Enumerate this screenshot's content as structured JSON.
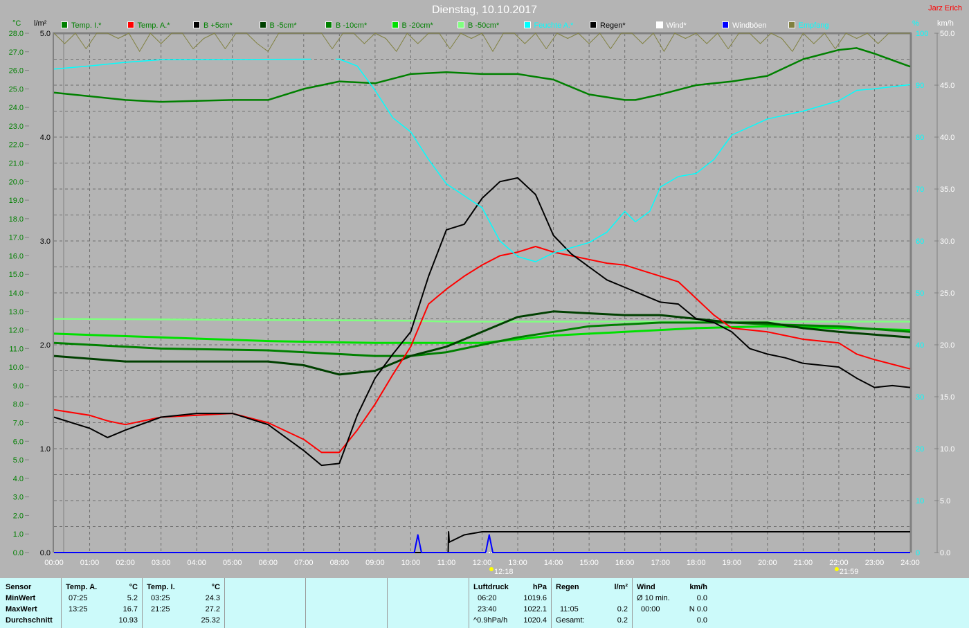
{
  "title": "Dienstag, 10.10.2017",
  "author": "Jarz Erich",
  "legend": [
    {
      "label": "Temp. I.*",
      "color": "#008000",
      "text_color": "#008000"
    },
    {
      "label": "Temp. A.*",
      "color": "#ff0000",
      "text_color": "#008000"
    },
    {
      "label": "B +5cm*",
      "color": "#000000",
      "text_color": "#008000"
    },
    {
      "label": "B -5cm*",
      "color": "#004000",
      "text_color": "#008000"
    },
    {
      "label": "B -10cm*",
      "color": "#008000",
      "text_color": "#008000"
    },
    {
      "label": "B -20cm*",
      "color": "#00e000",
      "text_color": "#008000"
    },
    {
      "label": "B -50cm*",
      "color": "#80ff80",
      "text_color": "#008000"
    },
    {
      "label": "Feuchte A.*",
      "color": "#00ffff",
      "text_color": "#00ffff"
    },
    {
      "label": "Regen*",
      "color": "#000000",
      "text_color": "#000000"
    },
    {
      "label": "Wind*",
      "color": "#ffffff",
      "text_color": "#ffffff"
    },
    {
      "label": "Windböen",
      "color": "#0000ff",
      "text_color": "#ffffff"
    },
    {
      "label": "Empfang",
      "color": "#808040",
      "text_color": "#00ffff"
    }
  ],
  "sun_markers": [
    {
      "label": "12:18",
      "hour": 12.3
    },
    {
      "label": "21:59",
      "hour": 21.98
    }
  ],
  "chart_data": {
    "type": "line",
    "title": "Dienstag, 10.10.2017",
    "x_ticks": [
      "00:00",
      "01:00",
      "02:00",
      "03:00",
      "04:00",
      "05:00",
      "06:00",
      "07:00",
      "08:00",
      "09:00",
      "10:00",
      "11:00",
      "12:00",
      "13:00",
      "14:00",
      "15:00",
      "16:00",
      "17:00",
      "18:00",
      "19:00",
      "20:00",
      "21:00",
      "22:00",
      "23:00",
      "24:00"
    ],
    "xlim": [
      0,
      24
    ],
    "axes": {
      "temp": {
        "unit": "°C",
        "ylim": [
          0,
          28
        ],
        "ticks": [
          "0.0",
          "1.0",
          "2.0",
          "3.0",
          "4.0",
          "5.0",
          "6.0",
          "7.0",
          "8.0",
          "9.0",
          "10.0",
          "11.0",
          "12.0",
          "13.0",
          "14.0",
          "15.0",
          "16.0",
          "17.0",
          "18.0",
          "19.0",
          "20.0",
          "21.0",
          "22.0",
          "23.0",
          "24.0",
          "25.0",
          "26.0",
          "27.0",
          "28.0"
        ]
      },
      "rain": {
        "unit": "l/m²",
        "ylim": [
          0,
          5
        ],
        "ticks": [
          "0.0",
          "1.0",
          "2.0",
          "3.0",
          "4.0",
          "5.0"
        ]
      },
      "humidity": {
        "unit": "%",
        "ylim": [
          0,
          100
        ],
        "ticks": [
          "0",
          "10",
          "20",
          "30",
          "40",
          "50",
          "60",
          "70",
          "80",
          "90",
          "100"
        ]
      },
      "wind": {
        "unit": "km/h",
        "ylim": [
          0,
          50
        ],
        "ticks": [
          "0.0",
          "5.0",
          "10.0",
          "15.0",
          "20.0",
          "25.0",
          "30.0",
          "35.0",
          "40.0",
          "45.0",
          "50.0"
        ]
      }
    },
    "series": [
      {
        "name": "Temp. I.*",
        "axis": "temp",
        "color": "#008000",
        "width": 2.5,
        "x": [
          0,
          2,
          3,
          5,
          6,
          7,
          8,
          9,
          10,
          11,
          12,
          13,
          14,
          15,
          16,
          16.3,
          17,
          18,
          19,
          20,
          21,
          22,
          22.5,
          23,
          24
        ],
        "y": [
          24.8,
          24.4,
          24.3,
          24.4,
          24.4,
          25.0,
          25.4,
          25.3,
          25.8,
          25.9,
          25.8,
          25.8,
          25.5,
          24.7,
          24.4,
          24.4,
          24.7,
          25.2,
          25.4,
          25.7,
          26.6,
          27.1,
          27.2,
          26.9,
          26.2
        ]
      },
      {
        "name": "B -50cm*",
        "axis": "temp",
        "color": "#80ff80",
        "width": 2.5,
        "x": [
          0,
          10,
          11,
          24
        ],
        "y": [
          12.6,
          12.5,
          12.45,
          12.45
        ]
      },
      {
        "name": "B -20cm*",
        "axis": "temp",
        "color": "#00e000",
        "width": 3,
        "x": [
          0,
          3,
          6,
          9,
          11,
          12,
          13,
          14,
          15,
          16,
          17,
          18,
          20,
          22,
          24
        ],
        "y": [
          11.8,
          11.6,
          11.4,
          11.3,
          11.3,
          11.3,
          11.5,
          11.7,
          11.8,
          11.9,
          12.0,
          12.1,
          12.2,
          12.1,
          12.0
        ]
      },
      {
        "name": "B -10cm*",
        "axis": "temp",
        "color": "#008000",
        "width": 3,
        "x": [
          0,
          3,
          6,
          8,
          9,
          10,
          11,
          12,
          13,
          14,
          15,
          16,
          17,
          18,
          19,
          20,
          22,
          24
        ],
        "y": [
          11.3,
          11.0,
          10.9,
          10.7,
          10.6,
          10.6,
          10.8,
          11.2,
          11.6,
          11.9,
          12.2,
          12.3,
          12.4,
          12.4,
          12.4,
          12.3,
          12.2,
          11.9
        ]
      },
      {
        "name": "B -5cm*",
        "axis": "temp",
        "color": "#004000",
        "width": 3,
        "x": [
          0,
          2,
          6,
          7,
          8,
          9,
          10,
          11,
          12,
          13,
          14,
          15,
          16,
          17,
          18,
          19,
          20,
          21,
          22,
          24
        ],
        "y": [
          10.6,
          10.3,
          10.3,
          10.1,
          9.6,
          9.8,
          10.6,
          11.1,
          11.9,
          12.7,
          13.0,
          12.9,
          12.8,
          12.8,
          12.6,
          12.4,
          12.4,
          12.1,
          11.9,
          11.6
        ]
      },
      {
        "name": "Temp. A.*",
        "axis": "temp",
        "color": "#ff0000",
        "width": 2,
        "x": [
          0,
          1,
          1.5,
          2,
          3,
          4,
          5,
          6,
          7,
          7.5,
          8,
          8.5,
          9,
          9.5,
          10,
          10.5,
          11,
          11.5,
          12,
          12.5,
          13,
          13.5,
          14,
          14.5,
          15,
          15.5,
          16,
          16.5,
          17,
          17.5,
          18,
          18.5,
          19,
          20,
          20.5,
          21,
          22,
          22.5,
          23,
          24
        ],
        "y": [
          7.7,
          7.4,
          7.1,
          6.9,
          7.3,
          7.4,
          7.5,
          7.0,
          6.1,
          5.4,
          5.4,
          6.6,
          8.0,
          9.6,
          11.1,
          13.4,
          14.2,
          14.9,
          15.5,
          16.0,
          16.2,
          16.5,
          16.2,
          16.0,
          15.8,
          15.6,
          15.5,
          15.2,
          14.9,
          14.6,
          13.7,
          12.8,
          12.1,
          11.9,
          11.7,
          11.5,
          11.3,
          10.7,
          10.4,
          9.9
        ]
      },
      {
        "name": "B +5cm*",
        "axis": "temp",
        "color": "#000000",
        "width": 2,
        "x": [
          0,
          1,
          1.5,
          2,
          3,
          4,
          5,
          6,
          7,
          7.5,
          8,
          8.5,
          9,
          9.5,
          10,
          10.5,
          11,
          11.5,
          12,
          12.5,
          13,
          13.5,
          14,
          14.5,
          15,
          15.5,
          16,
          16.5,
          17,
          17.5,
          18,
          18.5,
          19,
          19.5,
          20,
          20.5,
          21,
          22,
          22.5,
          23,
          23.5,
          24
        ],
        "y": [
          7.3,
          6.7,
          6.2,
          6.6,
          7.3,
          7.5,
          7.5,
          6.9,
          5.5,
          4.7,
          4.8,
          7.4,
          9.4,
          10.7,
          11.9,
          14.9,
          17.4,
          17.7,
          19.1,
          20.0,
          20.2,
          19.3,
          17.1,
          16.1,
          15.4,
          14.7,
          14.3,
          13.9,
          13.5,
          13.4,
          12.6,
          12.4,
          11.9,
          11.0,
          10.7,
          10.5,
          10.2,
          10.0,
          9.4,
          8.9,
          9.0,
          8.9
        ]
      },
      {
        "name": "Feuchte A.*",
        "axis": "humidity",
        "color": "#00ffff",
        "width": 1.5,
        "x": [
          0,
          1,
          2,
          3,
          7.2,
          null,
          7.9,
          8,
          8.5,
          9,
          9.5,
          10,
          10.5,
          11,
          12,
          12.5,
          13,
          13.5,
          14,
          15,
          15.5,
          16,
          16.3,
          16.7,
          17,
          17.5,
          18,
          18.5,
          19,
          20,
          21,
          22,
          22.5,
          23,
          24
        ],
        "y": [
          93.1,
          93.7,
          94.4,
          94.9,
          95.0,
          null,
          95.0,
          95.0,
          93.7,
          89.0,
          83.7,
          81.0,
          75.7,
          71.0,
          66.4,
          60.0,
          57.0,
          56.0,
          57.7,
          59.7,
          61.7,
          65.7,
          63.7,
          65.7,
          70.4,
          72.4,
          73.0,
          75.7,
          80.4,
          83.5,
          85.0,
          87.0,
          89.0,
          89.3,
          90.1
        ]
      },
      {
        "name": "Regen*",
        "axis": "rain",
        "color": "#000000",
        "width": 2,
        "x": [
          0,
          11.05,
          11.06,
          11.08,
          11.5,
          12,
          24
        ],
        "y": [
          0,
          0,
          0.2,
          0.1,
          0.17,
          0.2,
          0.2
        ]
      },
      {
        "name": "Windböen",
        "axis": "wind",
        "color": "#0000ff",
        "width": 2,
        "x": [
          0,
          10.1,
          10.2,
          10.3,
          12.1,
          12.2,
          12.3,
          24
        ],
        "y": [
          0,
          0,
          1.7,
          0,
          0,
          1.7,
          0,
          0
        ]
      },
      {
        "name": "Empfang",
        "axis": "humidity",
        "color": "#808040",
        "width": 1,
        "x": [
          0,
          0.3,
          0.6,
          0.9,
          1.2,
          1.5,
          1.8,
          2.1,
          2.4,
          2.7,
          3,
          3.3,
          3.6,
          3.9,
          4.2,
          4.5,
          4.8,
          5.1,
          5.4,
          5.7,
          6,
          6.3,
          6.6,
          6.9,
          7.2,
          7.5,
          7.8,
          8.1,
          8.4,
          8.7,
          9,
          9.3,
          9.6,
          9.9,
          10.2,
          10.5,
          10.8,
          11.1,
          11.4,
          11.7,
          12,
          12.3,
          12.6,
          12.9,
          13.2,
          13.5,
          13.8,
          14.1,
          14.4,
          14.7,
          15,
          15.3,
          15.6,
          15.9,
          16.2,
          16.5,
          16.8,
          17.1,
          17.4,
          17.7,
          18,
          18.3,
          18.6,
          18.9,
          19.2,
          19.5,
          19.8,
          20.1,
          20.4,
          20.7,
          21,
          21.3,
          21.6,
          21.9,
          22.2,
          22.5,
          22.8,
          23.1,
          23.4,
          23.7,
          24
        ],
        "y": [
          100,
          98,
          100,
          97,
          100,
          100,
          99,
          100,
          96.5,
          100,
          98,
          100,
          100,
          97,
          99,
          100,
          97,
          100,
          100,
          98,
          96.5,
          100,
          100,
          100,
          100,
          100,
          97,
          100,
          100,
          98,
          100,
          99,
          96.5,
          100,
          98,
          100,
          100,
          97,
          100,
          99,
          100,
          96.5,
          100,
          100,
          98,
          100,
          97,
          100,
          99,
          100,
          98,
          100,
          97,
          100,
          100,
          98,
          100,
          96.5,
          100,
          99,
          100,
          98,
          100,
          97,
          100,
          100,
          98,
          100,
          99,
          96.5,
          100,
          98,
          100,
          97,
          100,
          99,
          100,
          98,
          100,
          100,
          100
        ]
      }
    ]
  },
  "table": {
    "sensor": {
      "header": "Sensor",
      "rows": [
        "MinWert",
        "MaxWert",
        "Durchschnitt"
      ]
    },
    "temp_a": {
      "header": "Temp. A.",
      "unit": "°C",
      "min_time": "07:25",
      "min": "5.2",
      "max_time": "13:25",
      "max": "16.7",
      "avg": "10.93"
    },
    "temp_i": {
      "header": "Temp. I.",
      "unit": "°C",
      "min_time": "03:25",
      "min": "24.3",
      "max_time": "21:25",
      "max": "27.2",
      "avg": "25.32"
    },
    "pressure": {
      "header": "Luftdruck",
      "unit": "hPa",
      "min_time": "06:20",
      "min": "1019.6",
      "max_time": "23:40",
      "max": "1022.1",
      "trend": "^0.9hPa/h",
      "current": "1020.4"
    },
    "rain": {
      "header": "Regen",
      "unit": "l/m²",
      "time": "11:05",
      "value": "0.2",
      "total_label": "Gesamt:",
      "total": "0.2"
    },
    "wind": {
      "header": "Wind",
      "unit": "km/h",
      "avg_label": "Ø 10 min.",
      "avg": "0.0",
      "max_time": "00:00",
      "max": "N 0.0",
      "last": "0.0"
    }
  }
}
